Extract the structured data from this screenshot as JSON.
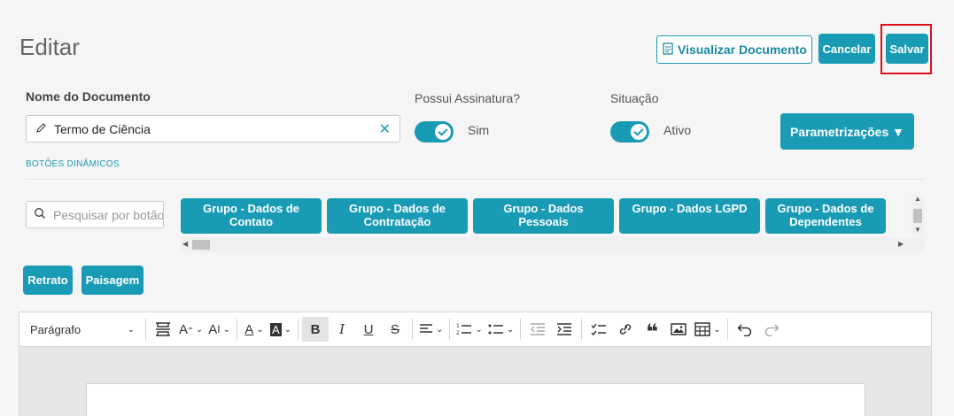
{
  "header": {
    "title": "Editar",
    "view_document_label": "Visualizar Documento",
    "cancel_label": "Cancelar",
    "save_label": "Salvar"
  },
  "form": {
    "doc_name_label": "Nome do Documento",
    "doc_name_value": "Termo de Ciência",
    "signature_label": "Possui Assinatura?",
    "signature_value": "Sim",
    "signature_on": true,
    "status_label": "Situação",
    "status_value": "Ativo",
    "status_on": true,
    "parametrizacoes_label": "Parametrizações ▼"
  },
  "dynamic_buttons": {
    "section_label": "BOTÕES DINÂMICOS",
    "search_placeholder": "Pesquisar por botão",
    "groups": [
      "Grupo - Dados de Contato",
      "Grupo - Dados de Contratação",
      "Grupo - Dados Pessoais",
      "Grupo - Dados LGPD",
      "Grupo - Dados de Dependentes"
    ]
  },
  "orientation": {
    "portrait_label": "Retrato",
    "landscape_label": "Paisagem"
  },
  "toolbar": {
    "paragraph_label": "Parágrafo",
    "icons": [
      "page-break-icon",
      "text-format-icon",
      "font-size-icon",
      "font-color-icon",
      "highlight-color-icon",
      "bold-icon",
      "italic-icon",
      "underline-icon",
      "strikethrough-icon",
      "align-icon",
      "numbered-list-icon",
      "bulleted-list-icon",
      "outdent-icon",
      "indent-icon",
      "todo-list-icon",
      "link-icon",
      "blockquote-icon",
      "image-icon",
      "table-icon",
      "undo-icon",
      "redo-icon"
    ]
  },
  "colors": {
    "accent": "#1a9bb5",
    "highlight_border": "#e0101a"
  }
}
